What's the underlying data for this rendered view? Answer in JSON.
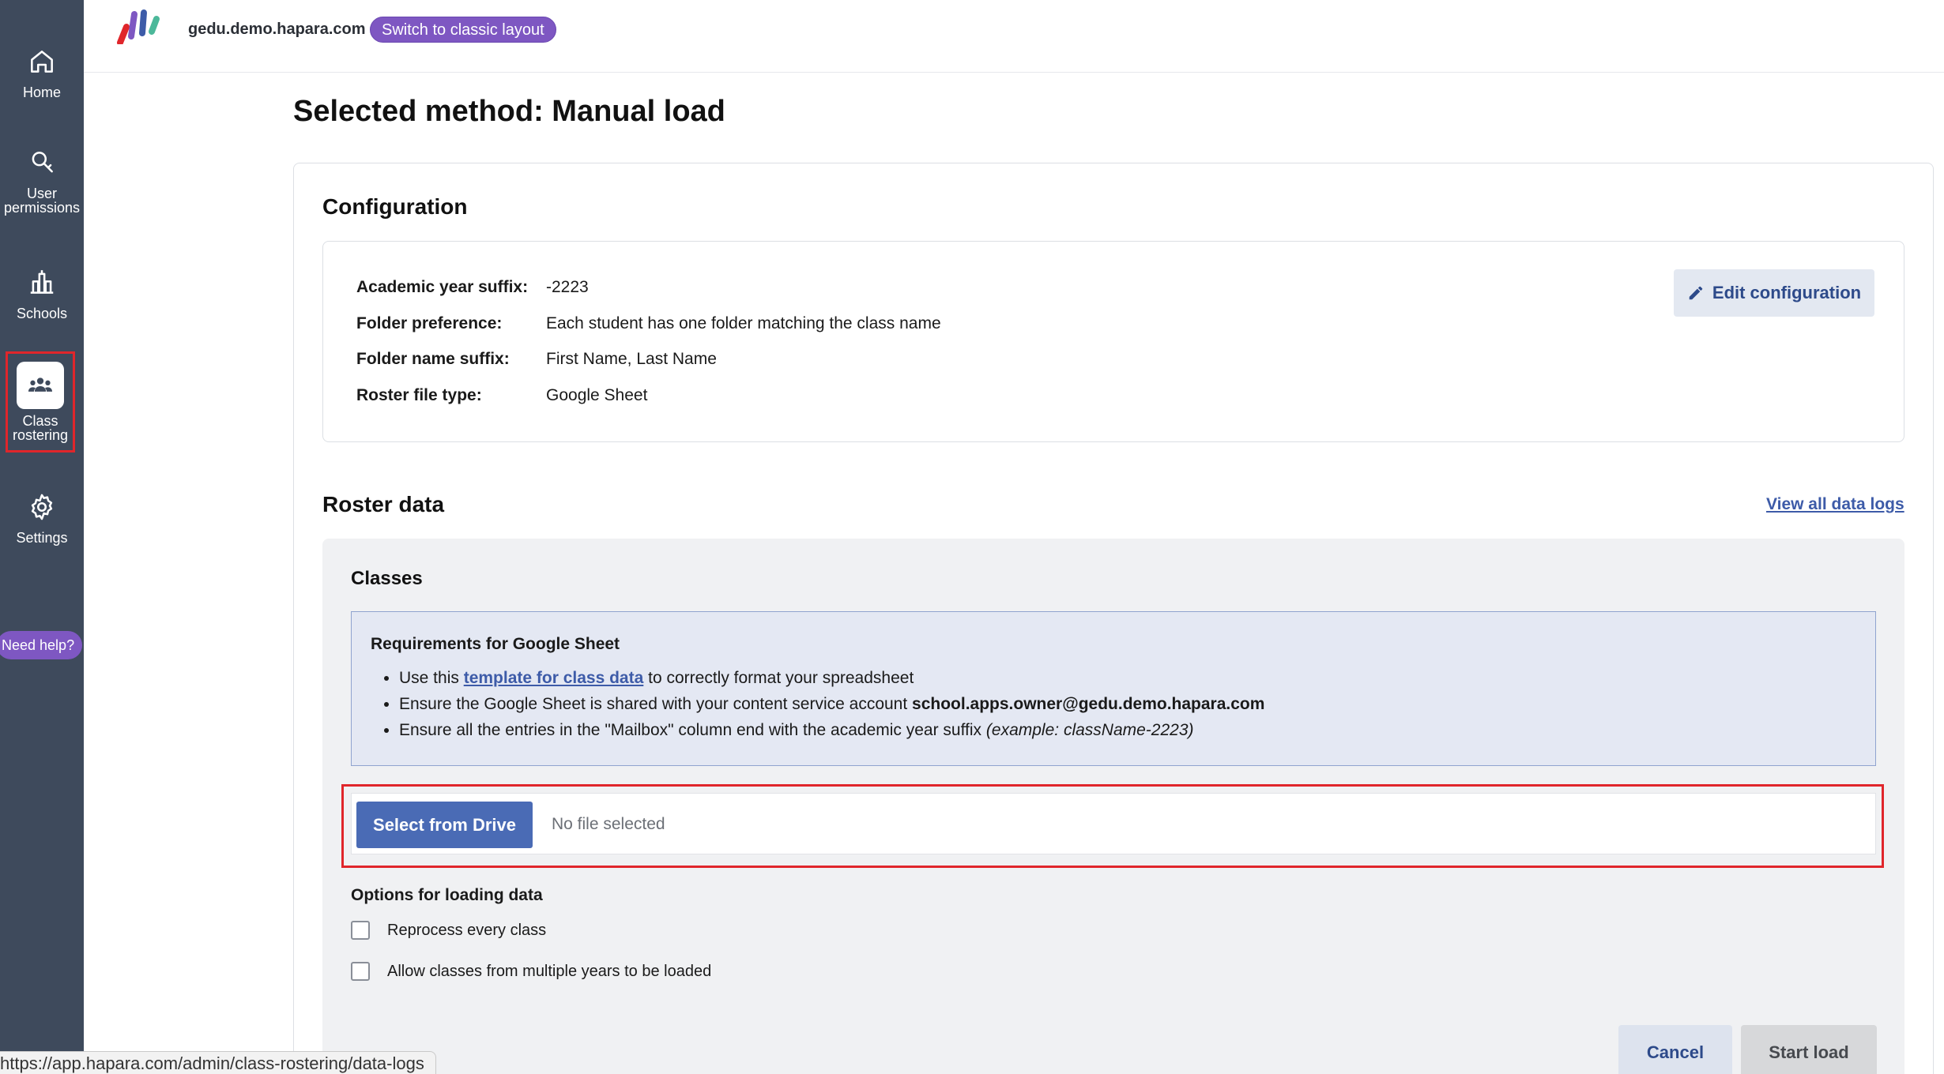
{
  "sidebar": {
    "items": [
      {
        "label": "Home",
        "icon": "home-icon"
      },
      {
        "label": "User permissions",
        "icon": "key-icon"
      },
      {
        "label": "Schools",
        "icon": "school-icon"
      },
      {
        "label": "Class rostering",
        "icon": "people-icon",
        "active": true
      },
      {
        "label": "Settings",
        "icon": "gear-icon"
      }
    ],
    "help_label": "Need help?"
  },
  "header": {
    "domain": "gedu.demo.hapara.com",
    "classic_layout_label": "Switch to classic layout"
  },
  "page": {
    "title_prefix": "Selected method:",
    "title_value": "Manual load"
  },
  "configuration": {
    "heading": "Configuration",
    "edit_label": "Edit configuration",
    "rows": [
      {
        "key": "Academic year suffix:",
        "value": "-2223"
      },
      {
        "key": "Folder preference:",
        "value": "Each student has one folder matching the class name"
      },
      {
        "key": "Folder name suffix:",
        "value": "First Name, Last Name"
      },
      {
        "key": "Roster file type:",
        "value": "Google Sheet"
      }
    ]
  },
  "roster": {
    "heading": "Roster data",
    "view_logs_label": "View all data logs",
    "classes_heading": "Classes",
    "requirements": {
      "title": "Requirements for Google Sheet",
      "item1_pre": "Use this ",
      "item1_link": "template for class data",
      "item1_post": " to correctly format your spreadsheet",
      "item2_pre": "Ensure the Google Sheet is shared with your content service account ",
      "item2_bold": "school.apps.owner@gedu.demo.hapara.com",
      "item3_pre": "Ensure all the entries in the \"Mailbox\" column end with the academic year suffix ",
      "item3_italic": "(example: className-2223)"
    },
    "select_drive_label": "Select from Drive",
    "no_file_label": "No file selected",
    "options_heading": "Options for loading data",
    "options": [
      {
        "label": "Reprocess every class",
        "checked": false
      },
      {
        "label": "Allow classes from multiple years to be loaded",
        "checked": false
      }
    ],
    "cancel_label": "Cancel",
    "start_label": "Start load"
  },
  "status_bar": {
    "url": "https://app.hapara.com/admin/class-rostering/data-logs"
  },
  "colors": {
    "sidebar": "#3e4a5c",
    "accent_purple": "#7e57c2",
    "primary_blue": "#4a6bb5",
    "highlight_red": "#e0262b"
  }
}
